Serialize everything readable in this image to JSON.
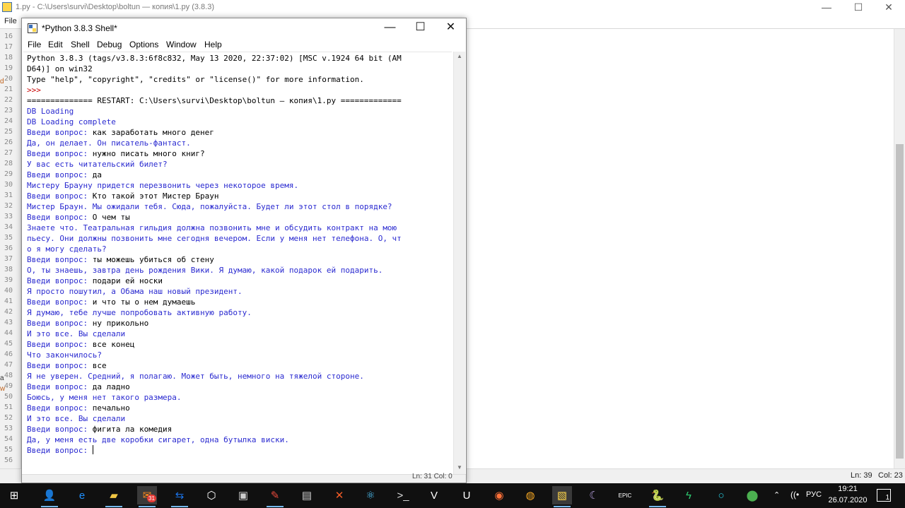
{
  "editor": {
    "title": "1.py - C:\\Users\\survi\\Desktop\\boltun — копия\\1.py (3.8.3)",
    "menu_file": "File",
    "line_numbers": [
      "16",
      "17",
      "18",
      "19",
      "20",
      "21",
      "22",
      "23",
      "24",
      "25",
      "26",
      "27",
      "28",
      "29",
      "30",
      "31",
      "32",
      "33",
      "34",
      "35",
      "36",
      "37",
      "38",
      "39",
      "40",
      "41",
      "42",
      "43",
      "44",
      "45",
      "46",
      "47",
      "48",
      "49",
      "50",
      "51",
      "52",
      "53",
      "54",
      "55",
      "56"
    ],
    "status_ln": "Ln: 39",
    "status_col": "Col: 23",
    "window_buttons": {
      "minimize": "—",
      "maximize": "☐",
      "close": "✕"
    }
  },
  "shell": {
    "title": "*Python 3.8.3 Shell*",
    "window_buttons": {
      "minimize": "—",
      "maximize": "☐",
      "close": "✕"
    },
    "menu": [
      "File",
      "Edit",
      "Shell",
      "Debug",
      "Options",
      "Window",
      "Help"
    ],
    "lines": [
      {
        "c": "blk",
        "t": "Python 3.8.3 (tags/v3.8.3:6f8c832, May 13 2020, 22:37:02) [MSC v.1924 64 bit (AM"
      },
      {
        "c": "blk",
        "t": "D64)] on win32"
      },
      {
        "c": "blk",
        "t": "Type \"help\", \"copyright\", \"credits\" or \"license()\" for more information."
      },
      {
        "c": "red",
        "t": ">>>"
      },
      {
        "c": "blk",
        "t": "============== RESTART: C:\\Users\\survi\\Desktop\\boltun — копия\\1.py ============="
      },
      {
        "c": "blue",
        "t": "DB Loading"
      },
      {
        "c": "blue",
        "t": "DB Loading complete"
      },
      {
        "c": "blue",
        "t": "Введи вопрос: ",
        "u": "как заработать много денег"
      },
      {
        "c": "blue",
        "t": "Да, он делает. Он писатель-фантаст."
      },
      {
        "c": "blue",
        "t": "Введи вопрос: ",
        "u": "нужно писать много книг?"
      },
      {
        "c": "blue",
        "t": "У вас есть читательский билет?"
      },
      {
        "c": "blue",
        "t": "Введи вопрос: ",
        "u": "да"
      },
      {
        "c": "blue",
        "t": "Мистеру Брауну придется перезвонить через некоторое время."
      },
      {
        "c": "blue",
        "t": "Введи вопрос: ",
        "u": "Кто такой этот Мистер Браун"
      },
      {
        "c": "blue",
        "t": "Мистер Браун. Мы ожидали тебя. Сюда, пожалуйста. Будет ли этот стол в порядке?"
      },
      {
        "c": "blue",
        "t": "Введи вопрос: ",
        "u": "О чем ты"
      },
      {
        "c": "blue",
        "t": "Знаете что. Театральная гильдия должна позвонить мне и обсудить контракт на мою"
      },
      {
        "c": "blue",
        "t": "пьесу. Они должны позвонить мне сегодня вечером. Если у меня нет телефона. О, чт"
      },
      {
        "c": "blue",
        "t": "о я могу сделать?"
      },
      {
        "c": "blue",
        "t": "Введи вопрос: ",
        "u": "ты можешь убиться об стену"
      },
      {
        "c": "blue",
        "t": "О, ты знаешь, завтра день рождения Вики. Я думаю, какой подарок ей подарить."
      },
      {
        "c": "blue",
        "t": "Введи вопрос: ",
        "u": "подари ей носки"
      },
      {
        "c": "blue",
        "t": "Я просто пошутил, а Обама наш новый президент."
      },
      {
        "c": "blue",
        "t": "Введи вопрос: ",
        "u": "и что ты о нем думаешь"
      },
      {
        "c": "blue",
        "t": "Я думаю, тебе лучше попробовать активную работу."
      },
      {
        "c": "blue",
        "t": "Введи вопрос: ",
        "u": "ну прикольно"
      },
      {
        "c": "blue",
        "t": "И это все. Вы сделали"
      },
      {
        "c": "blue",
        "t": "Введи вопрос: ",
        "u": "все конец"
      },
      {
        "c": "blue",
        "t": "Что закончилось?"
      },
      {
        "c": "blue",
        "t": "Введи вопрос: ",
        "u": "все"
      },
      {
        "c": "blue",
        "t": "Я не уверен. Средний, я полагаю. Может быть, немного на тяжелой стороне."
      },
      {
        "c": "blue",
        "t": "Введи вопрос: ",
        "u": "да ладно"
      },
      {
        "c": "blue",
        "t": "Боюсь, у меня нет такого размера."
      },
      {
        "c": "blue",
        "t": "Введи вопрос: ",
        "u": "печально"
      },
      {
        "c": "blue",
        "t": "И это все. Вы сделали"
      },
      {
        "c": "blue",
        "t": "Введи вопрос: ",
        "u": "фигита ла комедия"
      },
      {
        "c": "blue",
        "t": "Да, у меня есть две коробки сигарет, одна бутылка виски."
      },
      {
        "c": "blue",
        "t": "Введи вопрос: ",
        "caret": true
      }
    ],
    "status": "Ln: 31 Col: 0"
  },
  "taskbar": {
    "icons": [
      {
        "name": "start-icon",
        "glyph": "⊞",
        "color": "#ffffff"
      },
      {
        "name": "user-icon",
        "glyph": "👤",
        "color": "#5aa0e6"
      },
      {
        "name": "edge-icon",
        "glyph": "e",
        "color": "#1e90ff"
      },
      {
        "name": "folder-icon",
        "glyph": "▰",
        "color": "#f2c744"
      },
      {
        "name": "thunderbird-icon",
        "glyph": "✉",
        "color": "#ff8a1d",
        "badge": "31"
      },
      {
        "name": "teamviewer-icon",
        "glyph": "⇆",
        "color": "#1a73e8"
      },
      {
        "name": "cube-icon",
        "glyph": "⬡",
        "color": "#ffffff"
      },
      {
        "name": "archive-icon",
        "glyph": "▣",
        "color": "#cccccc"
      },
      {
        "name": "paint-icon",
        "glyph": "✎",
        "color": "#e84a3c"
      },
      {
        "name": "terminal-icon",
        "glyph": "▤",
        "color": "#cccccc"
      },
      {
        "name": "x-app-icon",
        "glyph": "✕",
        "color": "#f25c27"
      },
      {
        "name": "react-icon",
        "glyph": "⚛",
        "color": "#4fc3f7"
      },
      {
        "name": "console-icon",
        "glyph": ">_",
        "color": "#dddddd"
      },
      {
        "name": "vnc-icon",
        "glyph": "V",
        "color": "#ffffff"
      },
      {
        "name": "unreal-icon",
        "glyph": "U",
        "color": "#ffffff"
      },
      {
        "name": "firefox-icon",
        "glyph": "◉",
        "color": "#ff7139"
      },
      {
        "name": "planet-icon",
        "glyph": "◍",
        "color": "#f5a623"
      },
      {
        "name": "python-file-icon",
        "glyph": "▧",
        "color": "#ffd54a"
      },
      {
        "name": "eclipse-icon",
        "glyph": "☾",
        "color": "#b39ddb"
      },
      {
        "name": "epic-games-icon",
        "glyph": "EPIC",
        "color": "#ffffff"
      },
      {
        "name": "idle-icon",
        "glyph": "🐍",
        "color": "#4caf50"
      },
      {
        "name": "snake-app-icon",
        "glyph": "ϟ",
        "color": "#2ecc71"
      },
      {
        "name": "ring-icon",
        "glyph": "○",
        "color": "#26c6da"
      },
      {
        "name": "map-pin-icon",
        "glyph": "⬤",
        "color": "#4caf50"
      }
    ],
    "tray_caret": "⌃",
    "tray_net": "((•",
    "lang": "РУС",
    "time": "19:21",
    "date": "26.07.2020",
    "notify_count": "1"
  }
}
